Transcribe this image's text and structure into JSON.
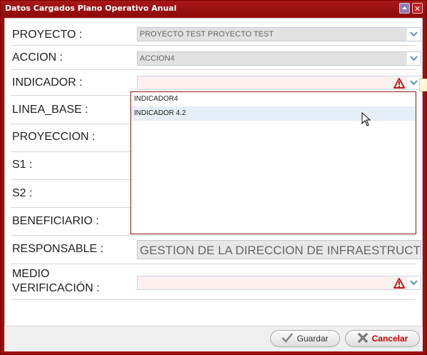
{
  "window": {
    "title": "Datos Cargados Plano Operativo Anual"
  },
  "form": {
    "proyecto": {
      "label": "PROYECTO :",
      "value": "PROYECTO TEST PROYECTO TEST"
    },
    "accion": {
      "label": "ACCION :",
      "value": "ACCION4"
    },
    "indicador": {
      "label": "INDICADOR :",
      "value": "",
      "options": [
        "INDICADOR4",
        "INDICADOR 4.2"
      ],
      "hovered_option": "INDICADOR 4.2"
    },
    "linea_base": {
      "label": "LINEA_BASE :"
    },
    "proyeccion": {
      "label": "PROYECCION :"
    },
    "s1": {
      "label": "S1 :"
    },
    "s2": {
      "label": "S2 :"
    },
    "beneficiario": {
      "label": "BENEFICIARIO :"
    },
    "responsable": {
      "label": "RESPONSABLE :",
      "value": "GESTION DE LA DIRECCION DE INFRAESTRUCTURA"
    },
    "medio_verificacion": {
      "label_line1": "MEDIO",
      "label_line2": "VERIFICACIÓN :",
      "value": ""
    }
  },
  "buttons": {
    "save": "Guardar",
    "cancel": "Cancelar"
  },
  "icons": {
    "minimize": "minimize-icon",
    "close": "close-icon",
    "dropdown": "chevron-down-icon",
    "warning": "warning-icon",
    "save": "checkmark-icon",
    "cancel": "x-icon"
  },
  "colors": {
    "title_bar": "#9b0f0f",
    "invalid_bg": "#fff0f0",
    "accent_cancel": "#cc0000"
  }
}
